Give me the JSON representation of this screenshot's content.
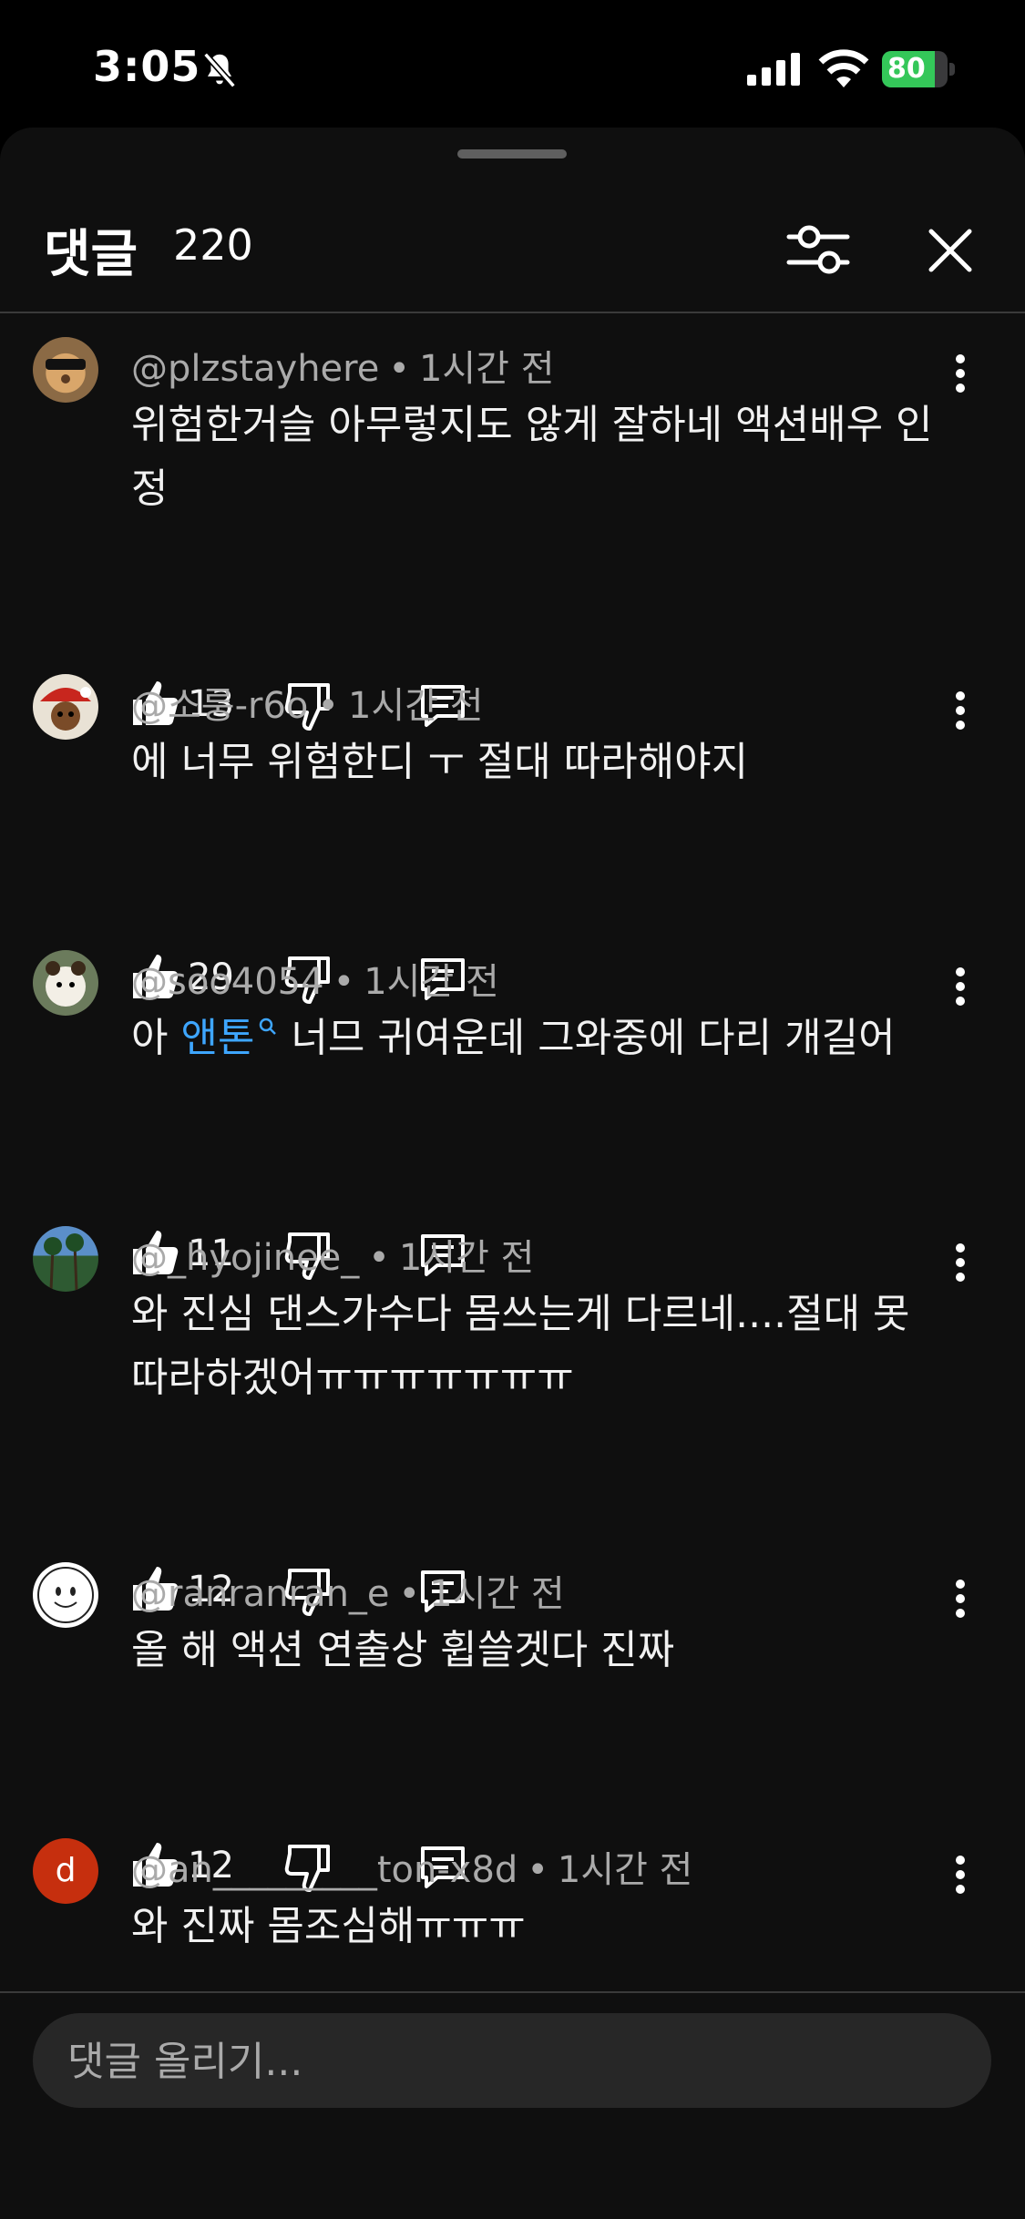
{
  "status": {
    "time": "3:05",
    "battery": "80"
  },
  "header": {
    "title": "댓글",
    "count": "220"
  },
  "comments": [
    {
      "author": "@plzstayhere",
      "time": "1시간 전",
      "text": "위험한거슬 아무렇지도 않게 잘하네 액션배우 인정",
      "likes": "13"
    },
    {
      "author": "@소룽-r6o",
      "time": "1시간 전",
      "text": "에 너무 위험한디 ㅜ 절대 따라해야지",
      "likes": "29"
    },
    {
      "author": "@soo4054",
      "time": "1시간 전",
      "text_pre": "아 ",
      "text_link": "앤톤",
      "text_post": " 너므 귀여운데 그와중에 다리 개길어",
      "likes": "11"
    },
    {
      "author": "@_hyojinee_",
      "time": "1시간 전",
      "text": "와 진심 댄스가수다 몸쓰는게 다르네....절대 못 따라하겠어ㅠㅠㅠㅠㅠㅠㅠ",
      "likes": "12"
    },
    {
      "author": "@ranranran_e",
      "time": "1시간 전",
      "text": "올 해 액션 연출상 휩쓸겟다 진짜",
      "likes": "12"
    },
    {
      "author": "@an_________ton-x8d",
      "time": "1시간 전",
      "text": "와 진짜 몸조심해ㅠㅠㅠ",
      "avatar_letter": "d"
    }
  ],
  "input": {
    "placeholder": "댓글 올리기..."
  },
  "colors": {
    "background": "#0f0f0f",
    "link": "#3ea6ff",
    "battery": "#34c759",
    "avatar_d": "#c62f0e"
  }
}
